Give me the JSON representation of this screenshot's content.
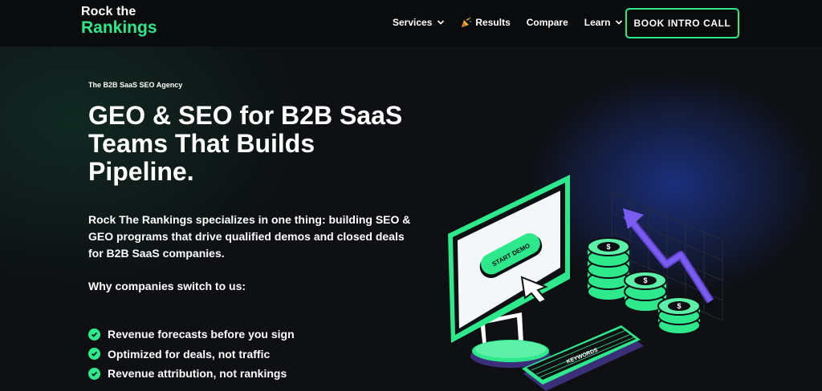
{
  "logo": {
    "line1": "Rock the",
    "line2": "Rankings"
  },
  "nav": {
    "items": [
      {
        "label": "Services",
        "has_dropdown": true
      },
      {
        "label": "Results",
        "icon": "party-popper-icon"
      },
      {
        "label": "Compare"
      },
      {
        "label": "Learn",
        "has_dropdown": true
      }
    ],
    "cta_label": "BOOK INTRO CALL"
  },
  "hero": {
    "eyebrow": "The B2B SaaS SEO Agency",
    "headline_lines": [
      "GEO & SEO for B2B SaaS",
      "Teams That Builds",
      "Pipeline."
    ],
    "intro_lines": [
      "Rock The Rankings specializes in one thing: building SEO &",
      "GEO programs that drive qualified demos and closed deals",
      "for B2B SaaS companies."
    ],
    "why_heading": "Why companies switch to us:",
    "benefits": [
      "Revenue forecasts before you sign",
      "Optimized for deals, not traffic",
      "Revenue attribution, not rankings"
    ]
  },
  "illustration": {
    "screen_button_label": "START DEMO",
    "keyboard_label": "KEYWORDS",
    "coin_symbol": "$"
  },
  "colors": {
    "accent": "#2ee88c",
    "background": "#0e1013",
    "nav_background": "#0a0b0d",
    "arrow": "#7b5cf0"
  }
}
